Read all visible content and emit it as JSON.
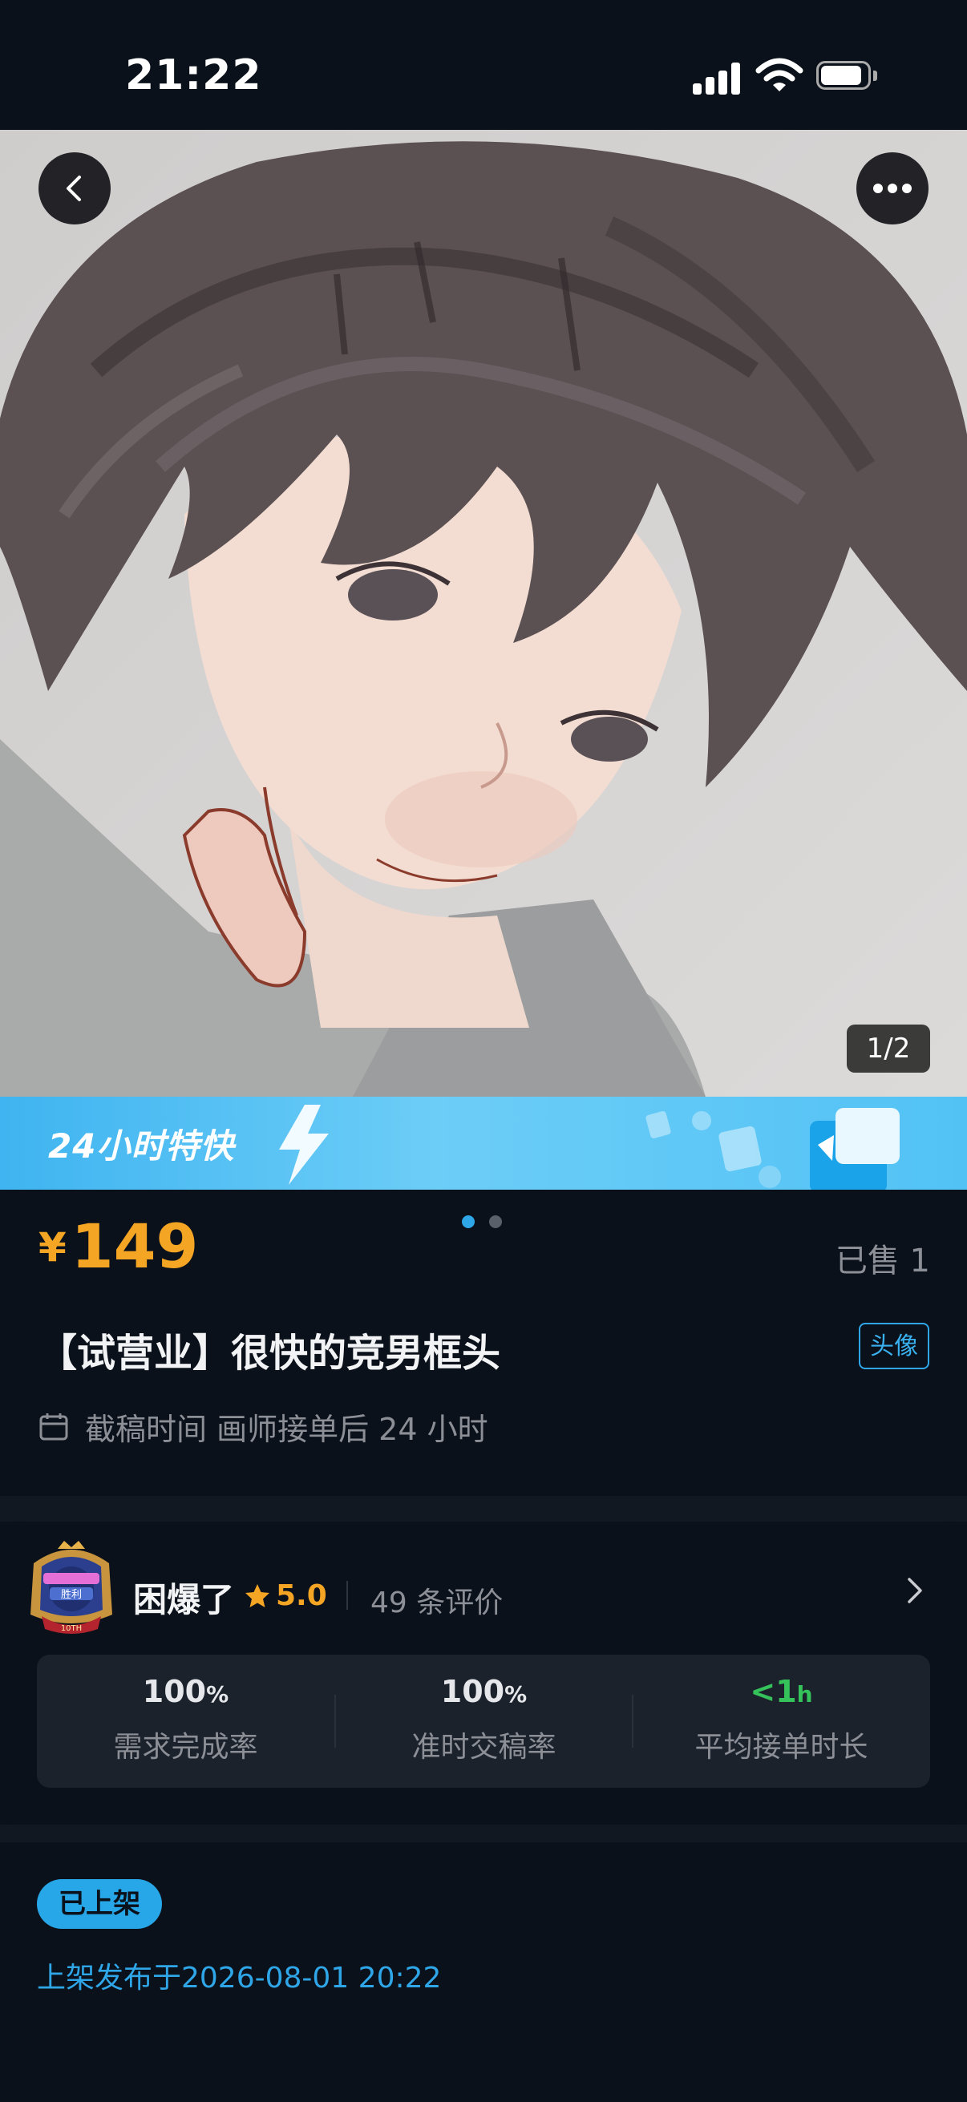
{
  "status_bar": {
    "time": "21:22"
  },
  "hero": {
    "page_indicator": "1/2"
  },
  "promo": {
    "text": "24小时特快"
  },
  "carousel": {
    "active_index": 0,
    "count": 2
  },
  "product": {
    "currency": "¥",
    "price": "149",
    "sold": "已售 1",
    "title": "【试营业】很快的竞男框头",
    "tag": "头像",
    "deadline": "截稿时间 画师接单后 24 小时"
  },
  "artist": {
    "name": "困爆了",
    "rating": "5.0",
    "reviews": "49 条评价",
    "stats": [
      {
        "value": "100",
        "unit": "%",
        "label": "需求完成率"
      },
      {
        "value": "100",
        "unit": "%",
        "label": "准时交稿率"
      },
      {
        "value": "<1",
        "unit": "h",
        "label": "平均接单时长"
      }
    ]
  },
  "listing": {
    "status": "已上架",
    "published": "上架发布于2026-08-01 20:22"
  },
  "colors": {
    "accent_orange": "#f5a524",
    "accent_blue": "#2ea6e8",
    "green": "#35c25a",
    "background": "#0b111a"
  }
}
